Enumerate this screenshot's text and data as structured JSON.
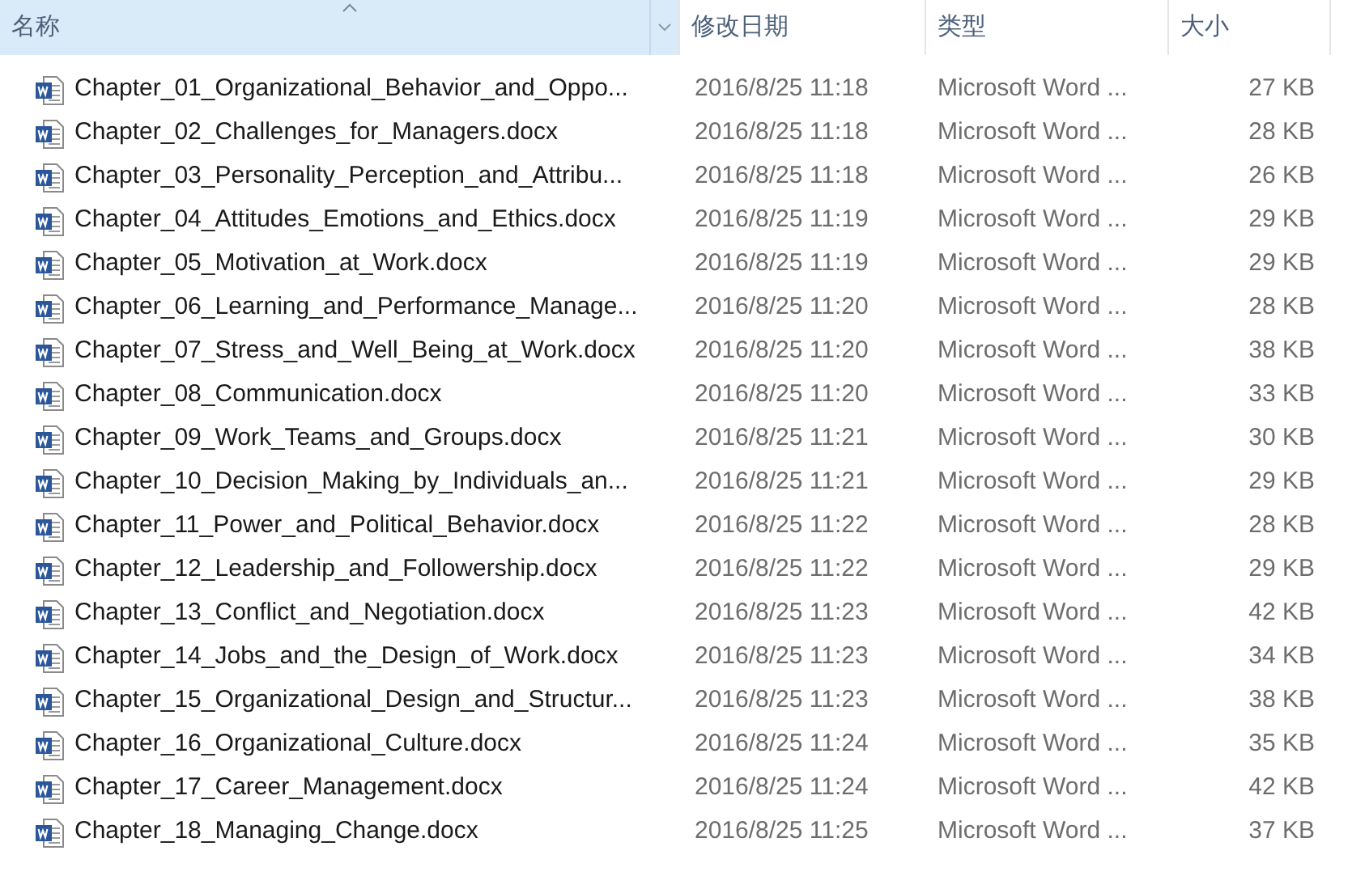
{
  "columns": [
    {
      "label": "名称",
      "selected": true
    },
    {
      "label": "修改日期",
      "selected": false
    },
    {
      "label": "类型",
      "selected": false
    },
    {
      "label": "大小",
      "selected": false
    }
  ],
  "rows": [
    {
      "name": "Chapter_01_Organizational_Behavior_and_Oppo...",
      "modified": "2016/8/25 11:18",
      "type": "Microsoft Word ...",
      "size": "27 KB"
    },
    {
      "name": "Chapter_02_Challenges_for_Managers.docx",
      "modified": "2016/8/25 11:18",
      "type": "Microsoft Word ...",
      "size": "28 KB"
    },
    {
      "name": "Chapter_03_Personality_Perception_and_Attribu...",
      "modified": "2016/8/25 11:18",
      "type": "Microsoft Word ...",
      "size": "26 KB"
    },
    {
      "name": "Chapter_04_Attitudes_Emotions_and_Ethics.docx",
      "modified": "2016/8/25 11:19",
      "type": "Microsoft Word ...",
      "size": "29 KB"
    },
    {
      "name": "Chapter_05_Motivation_at_Work.docx",
      "modified": "2016/8/25 11:19",
      "type": "Microsoft Word ...",
      "size": "29 KB"
    },
    {
      "name": "Chapter_06_Learning_and_Performance_Manage...",
      "modified": "2016/8/25 11:20",
      "type": "Microsoft Word ...",
      "size": "28 KB"
    },
    {
      "name": "Chapter_07_Stress_and_Well_Being_at_Work.docx",
      "modified": "2016/8/25 11:20",
      "type": "Microsoft Word ...",
      "size": "38 KB"
    },
    {
      "name": "Chapter_08_Communication.docx",
      "modified": "2016/8/25 11:20",
      "type": "Microsoft Word ...",
      "size": "33 KB"
    },
    {
      "name": "Chapter_09_Work_Teams_and_Groups.docx",
      "modified": "2016/8/25 11:21",
      "type": "Microsoft Word ...",
      "size": "30 KB"
    },
    {
      "name": "Chapter_10_Decision_Making_by_Individuals_an...",
      "modified": "2016/8/25 11:21",
      "type": "Microsoft Word ...",
      "size": "29 KB"
    },
    {
      "name": "Chapter_11_Power_and_Political_Behavior.docx",
      "modified": "2016/8/25 11:22",
      "type": "Microsoft Word ...",
      "size": "28 KB"
    },
    {
      "name": "Chapter_12_Leadership_and_Followership.docx",
      "modified": "2016/8/25 11:22",
      "type": "Microsoft Word ...",
      "size": "29 KB"
    },
    {
      "name": "Chapter_13_Conflict_and_Negotiation.docx",
      "modified": "2016/8/25 11:23",
      "type": "Microsoft Word ...",
      "size": "42 KB"
    },
    {
      "name": "Chapter_14_Jobs_and_the_Design_of_Work.docx",
      "modified": "2016/8/25 11:23",
      "type": "Microsoft Word ...",
      "size": "34 KB"
    },
    {
      "name": "Chapter_15_Organizational_Design_and_Structur...",
      "modified": "2016/8/25 11:23",
      "type": "Microsoft Word ...",
      "size": "38 KB"
    },
    {
      "name": "Chapter_16_Organizational_Culture.docx",
      "modified": "2016/8/25 11:24",
      "type": "Microsoft Word ...",
      "size": "35 KB"
    },
    {
      "name": "Chapter_17_Career_Management.docx",
      "modified": "2016/8/25 11:24",
      "type": "Microsoft Word ...",
      "size": "42 KB"
    },
    {
      "name": "Chapter_18_Managing_Change.docx",
      "modified": "2016/8/25 11:25",
      "type": "Microsoft Word ...",
      "size": "37 KB"
    }
  ]
}
